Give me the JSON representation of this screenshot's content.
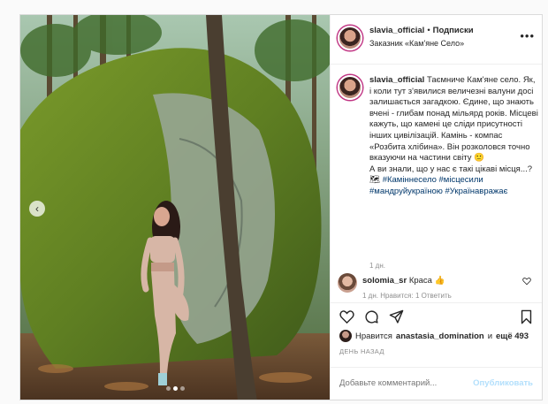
{
  "post": {
    "username": "slavia_official",
    "separator": "•",
    "follow_label": "Подписки",
    "location": "Заказник «Кам'яне Село»",
    "more_label": "•••",
    "caption_username": "slavia_official",
    "caption_body": "Таємниче Кам'яне село. Як, і коли тут з'явилися величезні валуни досі залишається загадкою. Єдине, що знають вчені - глибам понад мільярд років. Місцеві кажуть, що камені це сліди присутності інших цивілізацій. Камінь - компас «Розбита хлібина». Він розколовся точно вказуючи на частини світу 🙂\nА ви знали, що у нас є такі цікаві місця...? 🗺 ",
    "hashtags": "#Каміннесело #місцесили #мандруйукраїною #Українавражає",
    "caption_time": "1 дн.",
    "colors": {
      "link": "#00376b",
      "muted": "#8e8e8e",
      "publish": "#b2dffc",
      "border": "#dbdbdb"
    }
  },
  "comment": {
    "username": "solomia_sr",
    "text": "Краса 👍",
    "meta": "1 дн.   Нравится: 1   Ответить",
    "heart_icon": "heart-outline"
  },
  "actions": {
    "like_icon": "heart-outline",
    "comment_icon": "speech-bubble",
    "share_icon": "paper-plane",
    "save_icon": "bookmark"
  },
  "likes": {
    "prefix": "Нравится",
    "user": "anastasia_domination",
    "conj": "и",
    "rest": "ещё 493"
  },
  "date_label": "ДЕНЬ НАЗАД",
  "add_comment": {
    "placeholder": "Добавьте комментарий...",
    "publish_label": "Опубликовать"
  },
  "carousel": {
    "prev_icon": "chevron-left-icon",
    "dots_count": 3,
    "active_dot": 1
  }
}
